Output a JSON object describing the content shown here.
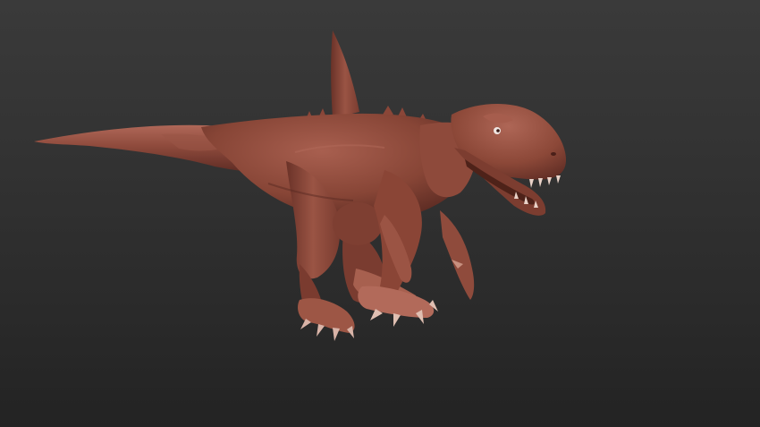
{
  "viewport": {
    "background_top": "#3a3a3a",
    "background_bottom": "#232323"
  },
  "model": {
    "subject": "t-rex-sculpt",
    "material_base": "#8e4a3c",
    "material_light": "#b2695a",
    "material_shadow": "#5a2a22",
    "claw_color": "#d9b4a8"
  }
}
